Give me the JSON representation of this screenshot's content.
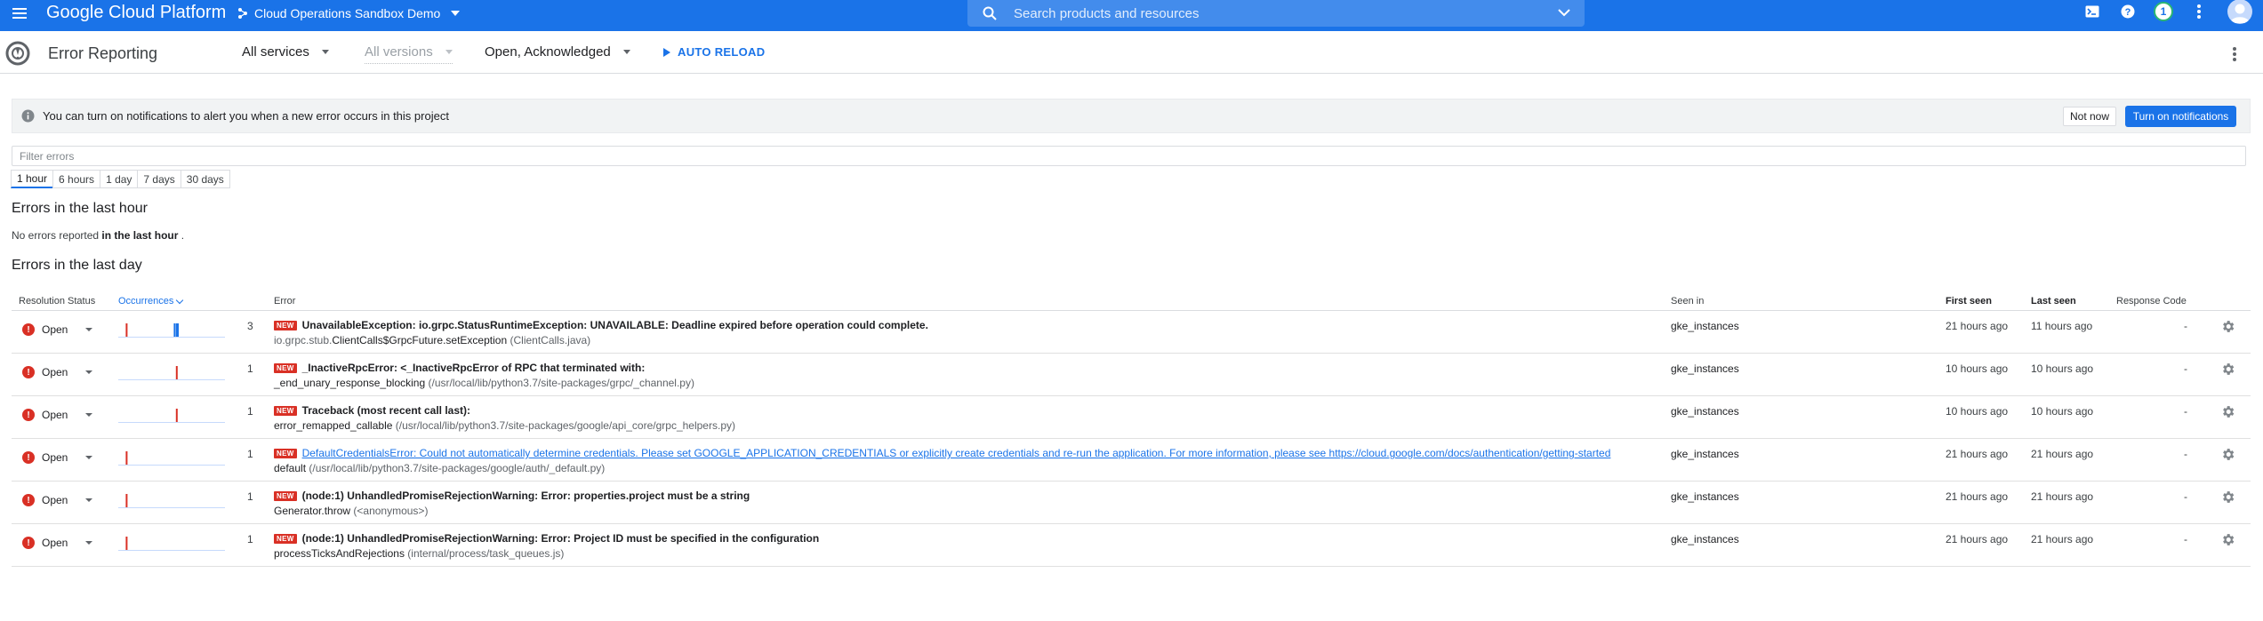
{
  "appbar": {
    "product": "Google Cloud Platform",
    "project": "Cloud Operations Sandbox Demo",
    "search_placeholder": "Search products and resources",
    "notification_count": "1"
  },
  "toolbar": {
    "title": "Error Reporting",
    "services": "All services",
    "versions": "All versions",
    "status_filter": "Open, Acknowledged",
    "auto_reload": "AUTO RELOAD"
  },
  "banner": {
    "message": "You can turn on notifications to alert you when a new error occurs in this project",
    "not_now": "Not now",
    "turn_on": "Turn on notifications"
  },
  "filter": {
    "placeholder": "Filter errors"
  },
  "ranges": [
    "1 hour",
    "6 hours",
    "1 day",
    "7 days",
    "30 days"
  ],
  "active_range": "1 hour",
  "last_hour": {
    "title": "Errors in the last hour",
    "empty_prefix": "No errors reported",
    "empty_bold": "in the last hour",
    "empty_suffix": "."
  },
  "last_day": {
    "title": "Errors in the last day"
  },
  "table": {
    "headers": {
      "status": "Resolution Status",
      "occurrences": "Occurrences",
      "error": "Error",
      "seen_in": "Seen in",
      "first_seen": "First seen",
      "last_seen": "Last seen",
      "response_code": "Response Code"
    },
    "new_badge": "NEW",
    "rows": [
      {
        "status": "Open",
        "count": "3",
        "title": "UnavailableException: io.grpc.StatusRuntimeException: UNAVAILABLE: Deadline expired before operation could complete.",
        "location_prefix": "io.grpc.stub.",
        "location_main": "ClientCalls$GrpcFuture.setException",
        "location_path": "(ClientCalls.java)",
        "seen_in": "gke_instances",
        "first_seen": "21 hours ago",
        "last_seen": "11 hours ago",
        "response_code": "-",
        "spark": [
          0.07,
          0.52,
          0.54,
          0.55
        ]
      },
      {
        "status": "Open",
        "count": "1",
        "title": "_InactiveRpcError: <_InactiveRpcError of RPC that terminated with:",
        "location_prefix": "",
        "location_main": "_end_unary_response_blocking",
        "location_path": "(/usr/local/lib/python3.7/site-packages/grpc/_channel.py)",
        "seen_in": "gke_instances",
        "first_seen": "10 hours ago",
        "last_seen": "10 hours ago",
        "response_code": "-",
        "spark": [
          0.54
        ]
      },
      {
        "status": "Open",
        "count": "1",
        "title": "Traceback (most recent call last):",
        "location_prefix": "",
        "location_main": "error_remapped_callable",
        "location_path": "(/usr/local/lib/python3.7/site-packages/google/api_core/grpc_helpers.py)",
        "seen_in": "gke_instances",
        "first_seen": "10 hours ago",
        "last_seen": "10 hours ago",
        "response_code": "-",
        "spark": [
          0.54
        ]
      },
      {
        "status": "Open",
        "count": "1",
        "title": "DefaultCredentialsError: Could not automatically determine credentials. Please set GOOGLE_APPLICATION_CREDENTIALS or explicitly create credentials and re-run the application. For more information, please see https://cloud.google.com/docs/authentication/getting-started",
        "is_link": true,
        "location_prefix": "",
        "location_main": "default",
        "location_path": "(/usr/local/lib/python3.7/site-packages/google/auth/_default.py)",
        "seen_in": "gke_instances",
        "first_seen": "21 hours ago",
        "last_seen": "21 hours ago",
        "response_code": "-",
        "spark": [
          0.07
        ]
      },
      {
        "status": "Open",
        "count": "1",
        "title": "(node:1) UnhandledPromiseRejectionWarning: Error: properties.project must be a string",
        "location_prefix": "",
        "location_main": "Generator.throw",
        "location_path": "(<anonymous>)",
        "seen_in": "gke_instances",
        "first_seen": "21 hours ago",
        "last_seen": "21 hours ago",
        "response_code": "-",
        "spark": [
          0.07
        ]
      },
      {
        "status": "Open",
        "count": "1",
        "title": "(node:1) UnhandledPromiseRejectionWarning: Error: Project ID must be specified in the configuration",
        "location_prefix": "",
        "location_main": "processTicksAndRejections",
        "location_path": "(internal/process/task_queues.js)",
        "seen_in": "gke_instances",
        "first_seen": "21 hours ago",
        "last_seen": "21 hours ago",
        "response_code": "-",
        "spark": [
          0.07
        ]
      }
    ]
  },
  "colors": {
    "brand": "#1a73e8",
    "error": "#d93025",
    "spark_old": "#d93025",
    "spark_new": "#1a73e8"
  }
}
